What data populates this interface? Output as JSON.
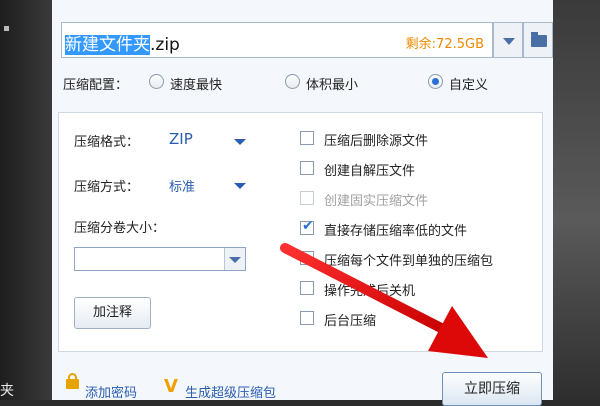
{
  "desktop": {
    "side_text": "夹"
  },
  "path": {
    "selected_text": "新建文件夹",
    "extension_text": ".zip",
    "free_space": "剩余:72.5GB"
  },
  "config": {
    "label": "压缩配置：",
    "options": [
      {
        "label": "速度最快",
        "selected": false
      },
      {
        "label": "体积最小",
        "selected": false
      },
      {
        "label": "自定义",
        "selected": true
      }
    ]
  },
  "panel": {
    "format_label": "压缩格式：",
    "format_value": "ZIP",
    "method_label": "压缩方式：",
    "method_value": "标准",
    "volume_label": "压缩分卷大小：",
    "volume_value": "",
    "comment_button": "加注释",
    "options": [
      {
        "label": "压缩后删除源文件",
        "checked": false,
        "disabled": false
      },
      {
        "label": "创建自解压文件",
        "checked": false,
        "disabled": false
      },
      {
        "label": "创建固实压缩文件",
        "checked": false,
        "disabled": true
      },
      {
        "label": "直接存储压缩率低的文件",
        "checked": true,
        "disabled": false
      },
      {
        "label": "压缩每个文件到单独的压缩包",
        "checked": false,
        "disabled": false
      },
      {
        "label": "操作完成后关机",
        "checked": false,
        "disabled": false
      },
      {
        "label": "后台压缩",
        "checked": false,
        "disabled": false
      }
    ]
  },
  "footer": {
    "add_password": "添加密码",
    "super_package": "生成超级压缩包",
    "compress_now": "立即压缩"
  },
  "colors": {
    "accent": "#2a5db0",
    "free_space": "#ef8a00",
    "arrow": "#e01010",
    "selection": "#3399ff"
  },
  "icons": [
    "chevron-down-icon",
    "folder-icon",
    "lock-icon",
    "v-icon",
    "checkmark-icon",
    "red-arrow-annotation"
  ]
}
